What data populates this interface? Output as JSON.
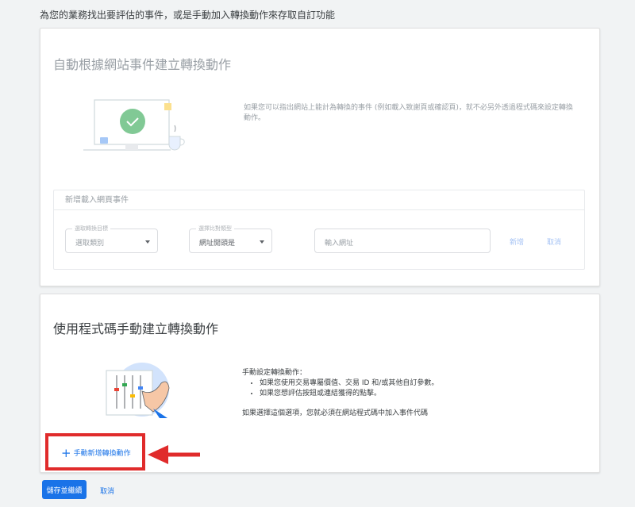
{
  "intro": "為您的業務找出要評估的事件，或是手動加入轉換動作來存取自訂功能",
  "auto_section": {
    "title": "自動根據網站事件建立轉換動作",
    "description": "如果您可以指出網站上能計為轉換的事件 (例如載入致謝頁或確認頁)，就不必另外透過程式碼來設定轉換動作。",
    "subpanel": {
      "title": "新增載入網頁事件",
      "fields": [
        {
          "label": "選取轉換目標",
          "value": "選取類別"
        },
        {
          "label": "選擇比對類型",
          "value": "網址開頭是"
        },
        {
          "label": "",
          "value": "輸入網址"
        }
      ],
      "add_label": "新增",
      "cancel_label": "取消"
    }
  },
  "manual_section": {
    "title": "使用程式碼手動建立轉換動作",
    "heading": "手動設定轉換動作：",
    "bullets": [
      "如果您使用交易專屬價值、交易 ID 和/或其他自訂參數。",
      "如果您想評估按鈕或連結獲得的點擊。"
    ],
    "note": "如果選擇這個選項，您就必須在網站程式碼中加入事件代碼",
    "add_button": "手動新增轉換動作"
  },
  "footer": {
    "save_label": "儲存並繼續",
    "cancel_label": "取消"
  },
  "colors": {
    "accent": "#1a73e8",
    "annotation": "#e02b2b",
    "check_green": "#81c995"
  }
}
